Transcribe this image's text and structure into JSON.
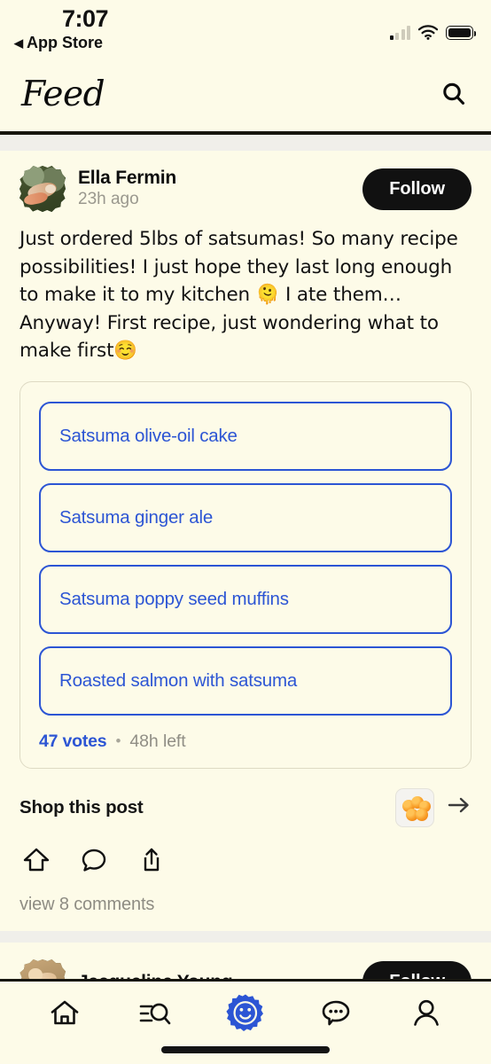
{
  "status_bar": {
    "time": "7:07",
    "back_label": "App Store",
    "back_glyph": "◀",
    "icons": [
      "cellular-signal-icon",
      "wifi-icon",
      "battery-icon"
    ]
  },
  "header": {
    "title": "Feed",
    "search_icon": "search-icon"
  },
  "post": {
    "author": "Ella Fermin",
    "timestamp": "23h ago",
    "follow_label": "Follow",
    "text": "Just ordered 5lbs of satsumas! So many recipe possibilities! I just hope they last long enough to make it to my kitchen 🫠 I ate them… Anyway! First recipe, just wondering what to make first☺️",
    "poll": {
      "options": [
        "Satsuma olive-oil cake",
        "Satsuma ginger ale",
        "Satsuma poppy seed muffins",
        "Roasted salmon with satsuma"
      ],
      "votes_label": "47 votes",
      "separator": "•",
      "time_left": "48h left"
    },
    "shop": {
      "label": "Shop this post",
      "product_thumb": "satsumas-product-thumbnail",
      "arrow_icon": "arrow-right-icon"
    },
    "actions": [
      "upvote-icon",
      "comment-icon",
      "share-icon"
    ],
    "comments_link": "view 8 comments"
  },
  "next_post": {
    "author": "Jacqueline Young",
    "follow_label": "Follow"
  },
  "tab_bar": {
    "items": [
      {
        "name": "home",
        "icon": "home-icon",
        "active": false
      },
      {
        "name": "search",
        "icon": "search-list-icon",
        "active": false
      },
      {
        "name": "smiley",
        "icon": "smiley-badge-icon",
        "active": true
      },
      {
        "name": "messages",
        "icon": "chat-bubble-icon",
        "active": false
      },
      {
        "name": "profile",
        "icon": "person-icon",
        "active": false
      }
    ]
  },
  "colors": {
    "background": "#FDFBE8",
    "ink": "#111111",
    "accent_blue": "#2C55D4",
    "muted": "#908E85",
    "separator": "#F0EFEA"
  }
}
